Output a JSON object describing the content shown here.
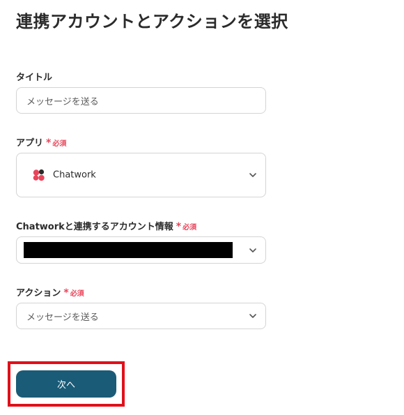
{
  "page": {
    "title": "連携アカウントとアクションを選択"
  },
  "required": {
    "mark": "*",
    "text": "必須"
  },
  "title_field": {
    "label": "タイトル",
    "value": "メッセージを送る"
  },
  "app_field": {
    "label": "アプリ",
    "app_name": "Chatwork",
    "icon": "chatwork-logo",
    "chevron_icon": "chevron-down-icon"
  },
  "account_field": {
    "label": "Chatworkと連携するアカウント情報",
    "chevron_icon": "chevron-down-icon"
  },
  "action_field": {
    "label": "アクション",
    "value": "メッセージを送る",
    "chevron_icon": "chevron-down-icon"
  },
  "next_button": {
    "label": "次へ"
  },
  "colors": {
    "primary_button": "#1a5b77",
    "required": "#e8455a",
    "highlight": "#e0101a",
    "border": "#d4d4d4"
  }
}
